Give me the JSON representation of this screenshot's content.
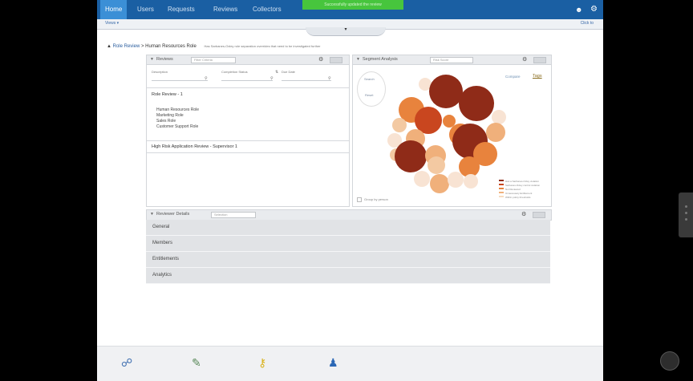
{
  "nav": {
    "tabs": [
      "Home",
      "Users",
      "Requests",
      "Reviews",
      "Collectors"
    ],
    "banner": "Successfully updated the review"
  },
  "subbar": {
    "left": "Views ▾",
    "right": "Click to"
  },
  "breadcrumb": {
    "root": "Role Review",
    "current": "Human Resources Role",
    "description": "Has Sarbanes-Oxley role separation overrides that need to be investigated further"
  },
  "reviews_panel": {
    "title": "Reviews",
    "select": "Filter Criteria",
    "filters": [
      {
        "label": "Description"
      },
      {
        "label": "Completion Status"
      },
      {
        "label": "Due Date"
      }
    ],
    "groups": [
      {
        "title": "Role Review - 1",
        "items": [
          "Human Resources Role",
          "Marketing Role",
          "Sales Role",
          "Customer Support Role"
        ]
      },
      {
        "title": "High Risk Application Review - Supervisor 1",
        "items": []
      }
    ]
  },
  "segment_panel": {
    "title": "Segment Analysis",
    "select": "Risk Score",
    "side_buttons": [
      "Search",
      "Reset"
    ],
    "links": [
      "Compare",
      "Tags"
    ],
    "checkbox_label": "Group by person",
    "legend": [
      {
        "label": "Has a Sarbanes-Oxley violation",
        "color": "#8f2b18"
      },
      {
        "label": "Sarbanes-Oxley control violation",
        "color": "#c9461f"
      },
      {
        "label": "Not Reviewed",
        "color": "#e8833d"
      },
      {
        "label": "Unnecessary Entitlement",
        "color": "#f0b07b"
      },
      {
        "label": "Within policy thresholds",
        "color": "#f6dcc0"
      }
    ]
  },
  "details_panel": {
    "title": "Reviewer Details",
    "select": "Selection",
    "sections": [
      "General",
      "Members",
      "Entitlements",
      "Analytics"
    ]
  },
  "dock": {
    "icons": [
      "users-icon",
      "report-icon",
      "keys-icon",
      "person-icon"
    ]
  }
}
